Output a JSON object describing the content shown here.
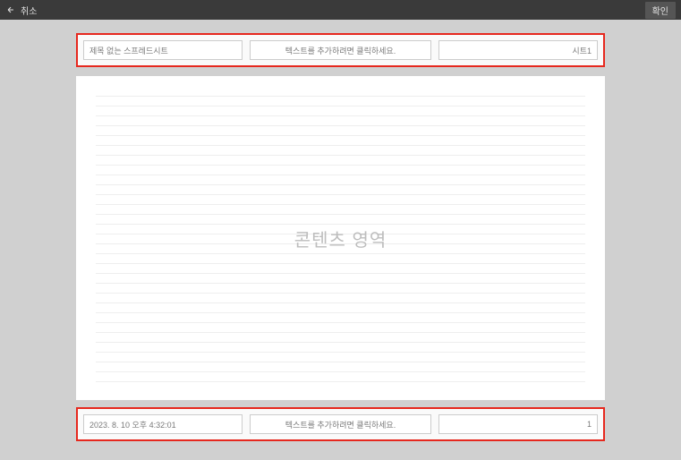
{
  "topbar": {
    "cancel": "취소",
    "confirm": "확인"
  },
  "header": {
    "title": "제목 없는 스프레드시트",
    "center_placeholder": "텍스트를 추가하려면 클릭하세요.",
    "sheet_name": "시트1"
  },
  "content": {
    "placeholder": "콘텐츠 영역"
  },
  "footer": {
    "timestamp": "2023. 8. 10 오후 4:32:01",
    "center_placeholder": "텍스트를 추가하려면 클릭하세요.",
    "page_number": "1"
  }
}
